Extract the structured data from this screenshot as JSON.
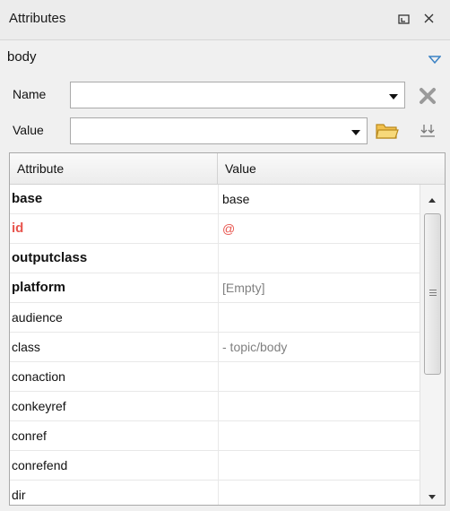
{
  "panel": {
    "title": "Attributes"
  },
  "element": {
    "name": "body"
  },
  "filter": {
    "name_label": "Name",
    "name_value": "",
    "value_label": "Value",
    "value_value": ""
  },
  "table": {
    "headers": {
      "attribute": "Attribute",
      "value": "Value"
    },
    "rows": [
      {
        "name": "base",
        "value": "base",
        "style": "bold"
      },
      {
        "name": "id",
        "value": "@",
        "style": "bold-red"
      },
      {
        "name": "outputclass",
        "value": "",
        "style": "bold"
      },
      {
        "name": "platform",
        "value": "[Empty]",
        "style": "bold"
      },
      {
        "name": "audience",
        "value": "",
        "style": "normal"
      },
      {
        "name": "class",
        "value": "- topic/body",
        "style": "normal"
      },
      {
        "name": "conaction",
        "value": "",
        "style": "normal"
      },
      {
        "name": "conkeyref",
        "value": "",
        "style": "normal"
      },
      {
        "name": "conref",
        "value": "",
        "style": "normal"
      },
      {
        "name": "conrefend",
        "value": "",
        "style": "normal"
      },
      {
        "name": "dir",
        "value": "",
        "style": "normal"
      }
    ]
  },
  "colors": {
    "accent": "#3b82c4",
    "required_attr": "#e8554e",
    "folder": "#f2c14e"
  },
  "icons": [
    "restore-icon",
    "close-icon",
    "filter-dropdown-icon",
    "dropdown-arrow-icon",
    "clear-icon",
    "folder-icon",
    "sort-icon",
    "scroll-up-icon",
    "scroll-down-icon"
  ]
}
